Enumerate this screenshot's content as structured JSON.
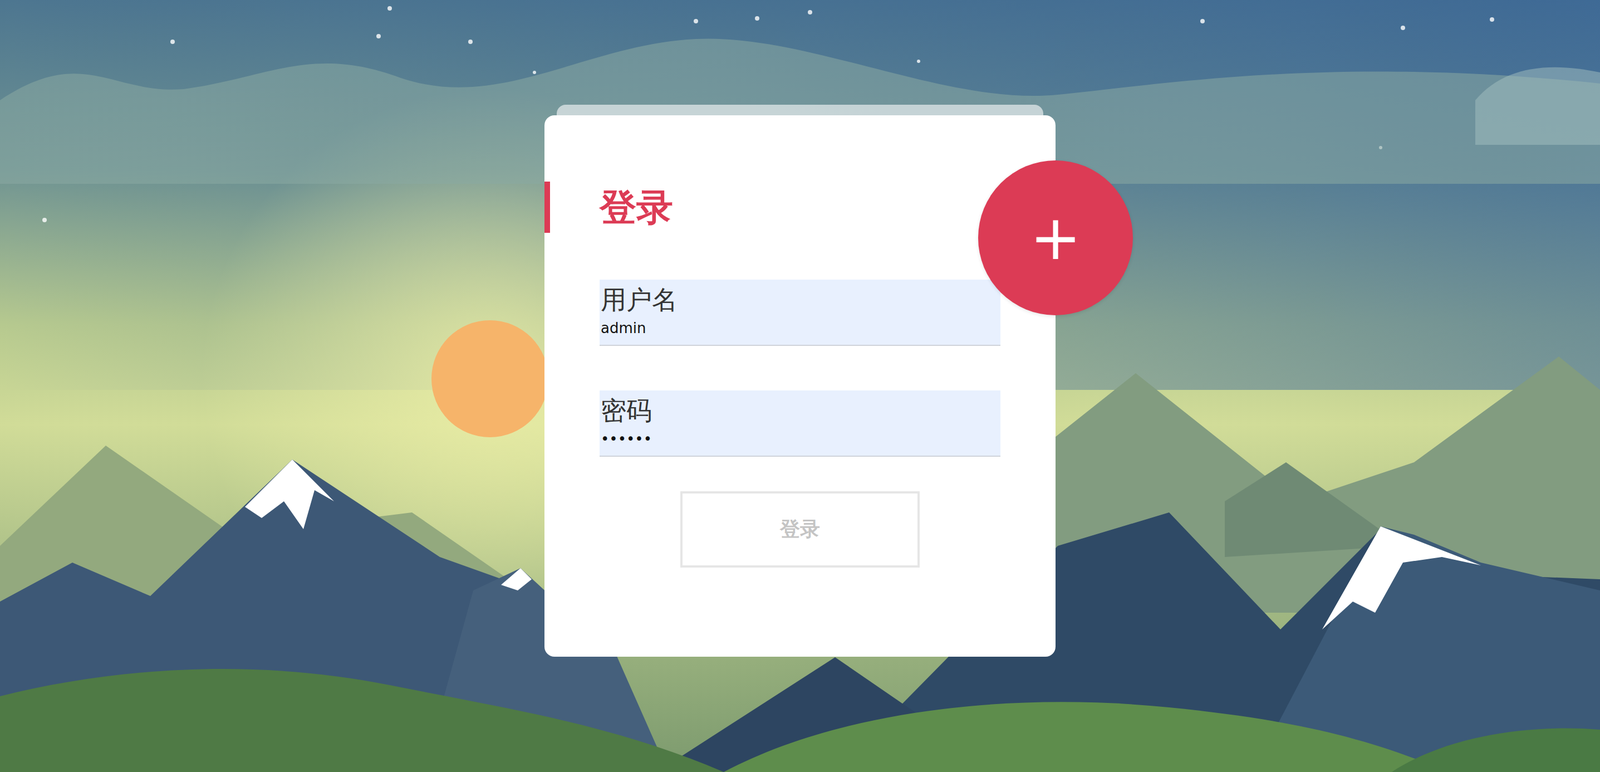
{
  "form": {
    "title": "登录",
    "fields": [
      {
        "label": "用户名",
        "value": "admin"
      },
      {
        "label": "密码",
        "value": "••••••"
      }
    ],
    "submit": {
      "label": "登录",
      "disabled": true
    }
  },
  "fab": {
    "label": "+"
  }
}
